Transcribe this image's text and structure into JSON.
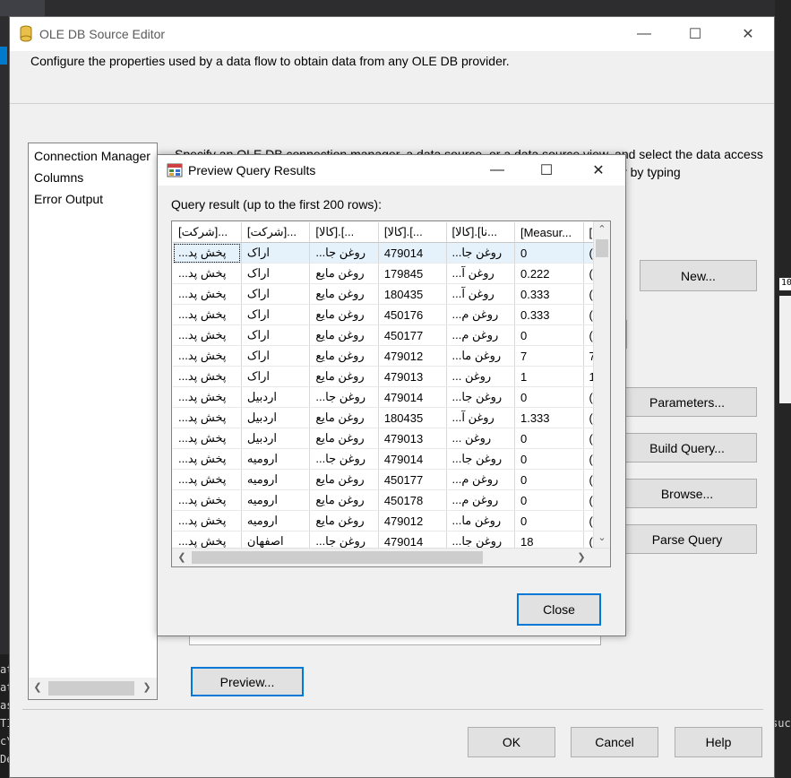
{
  "dialog": {
    "title": "OLE DB Source Editor",
    "description": "Configure the properties used by a data flow to obtain data from any OLE DB provider.",
    "nav_items": [
      "Connection Manager",
      "Columns",
      "Error Output"
    ],
    "right_text": "Specify an OLE DB connection manager, a data source, or a data source view, and select the data access mode. If using the SQL command access mode, specify the SQL command either by typing",
    "buttons": {
      "new": "New...",
      "parameters": "Parameters...",
      "build_query": "Build Query...",
      "browse": "Browse...",
      "parse_query": "Parse Query",
      "preview": "Preview...",
      "ok": "OK",
      "cancel": "Cancel",
      "help": "Help"
    }
  },
  "preview": {
    "title": "Preview Query Results",
    "label": "Query result (up to the first 200 rows):",
    "close_label": "Close",
    "columns": [
      "[شرکت]...",
      "[شرکت]...",
      "[کالا].[...",
      "[کالا].[...",
      "[کالا].[نا...",
      "[Measur...",
      "["
    ],
    "rows": [
      [
        "پخش پد...",
        "اراک",
        "روغن جا...",
        "479014",
        "روغن جا...",
        "0",
        "("
      ],
      [
        "پخش پد...",
        "اراک",
        "روغن مایع",
        "179845",
        "روغن آ...",
        "0.222",
        "("
      ],
      [
        "پخش پد...",
        "اراک",
        "روغن مایع",
        "180435",
        "روغن آ...",
        "0.333",
        "("
      ],
      [
        "پخش پد...",
        "اراک",
        "روغن مایع",
        "450176",
        "روغن م...",
        "0.333",
        "("
      ],
      [
        "پخش پد...",
        "اراک",
        "روغن مایع",
        "450177",
        "روغن م...",
        "0",
        "("
      ],
      [
        "پخش پد...",
        "اراک",
        "روغن مایع",
        "479012",
        "روغن ما...",
        "7",
        "7"
      ],
      [
        "پخش پد...",
        "اراک",
        "روغن مایع",
        "479013",
        "روغن ...",
        "1",
        "1"
      ],
      [
        "پخش پد...",
        "اردبیل",
        "روغن جا...",
        "479014",
        "روغن جا...",
        "0",
        "("
      ],
      [
        "پخش پد...",
        "اردبیل",
        "روغن مایع",
        "180435",
        "روغن آ...",
        "1.333",
        "("
      ],
      [
        "پخش پد...",
        "اردبیل",
        "روغن مایع",
        "479013",
        "روغن ...",
        "0",
        "("
      ],
      [
        "پخش پد...",
        "ارومیه",
        "روغن جا...",
        "479014",
        "روغن جا...",
        "0",
        "("
      ],
      [
        "پخش پد...",
        "ارومیه",
        "روغن مایع",
        "450177",
        "روغن م...",
        "0",
        "("
      ],
      [
        "پخش پد...",
        "ارومیه",
        "روغن مایع",
        "450178",
        "روغن م...",
        "0",
        "("
      ],
      [
        "پخش پد...",
        "ارومیه",
        "روغن مایع",
        "479012",
        "روغن ما...",
        "0",
        "("
      ],
      [
        "پخش پد...",
        "اصفهان",
        "روغن جا...",
        "479014",
        "روغن جا...",
        "18",
        "("
      ]
    ]
  },
  "background": {
    "left_fragments": [
      "at",
      "at",
      "as",
      "TI",
      "c\\",
      "De"
    ],
    "right_fragments": [
      "10",
      "suc"
    ]
  }
}
